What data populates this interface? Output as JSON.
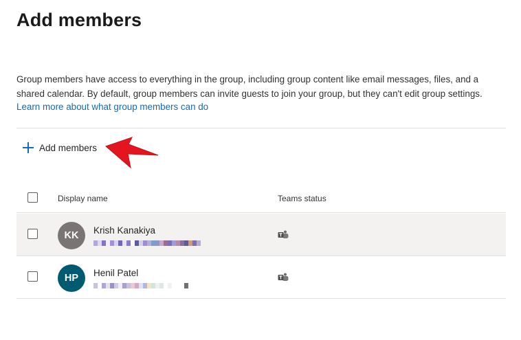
{
  "page": {
    "title": "Add members",
    "description": "Group members have access to everything in the group, including group content like email messages, files, and a shared calendar. By default, group members can invite guests to join your group, but they can't edit group settings.",
    "learn_more_link": "Learn more about what group members can do"
  },
  "toolbar": {
    "add_members_label": "Add members",
    "add_icon": "plus-icon",
    "annotation": "red-arrow-icon"
  },
  "table": {
    "columns": {
      "display_name": "Display name",
      "teams_status": "Teams status"
    },
    "rows": [
      {
        "initials": "KK",
        "name": "Krish Kanakiya",
        "avatar_color": "#7a7574",
        "email": "redacted",
        "teams_status_icon": "teams-icon"
      },
      {
        "initials": "HP",
        "name": "Henil Patel",
        "avatar_color": "#005b70",
        "email": "redacted",
        "teams_status_icon": "teams-icon"
      }
    ]
  },
  "colors": {
    "accent": "#0f6cbd",
    "row_highlight": "#f3f2f1",
    "annotation_arrow": "#e3161f"
  }
}
